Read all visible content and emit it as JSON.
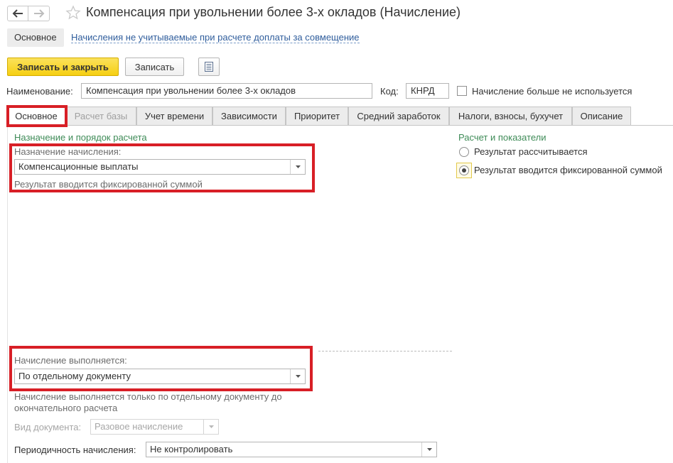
{
  "window": {
    "title": "Компенсация при увольнении более 3-х окладов (Начисление)"
  },
  "icons": {
    "back": "arrow-left-icon",
    "forward": "arrow-right-icon",
    "favorite": "star-icon",
    "list": "list-icon",
    "dropdown": "chevron-down-icon"
  },
  "subnav": {
    "main": "Основное",
    "link": "Начисления не учитываемые при расчете доплаты за совмещение"
  },
  "toolbar": {
    "save_close": "Записать и закрыть",
    "save": "Записать"
  },
  "header_fields": {
    "name_label": "Наименование:",
    "name_value": "Компенсация при увольнении более 3-х окладов",
    "code_label": "Код:",
    "code_value": "КНРД",
    "unused_label": "Начисление больше не используется"
  },
  "tabs": [
    {
      "label": "Основное",
      "active": true
    },
    {
      "label": "Расчет базы",
      "disabled": true
    },
    {
      "label": "Учет времени"
    },
    {
      "label": "Зависимости"
    },
    {
      "label": "Приоритет"
    },
    {
      "label": "Средний заработок"
    },
    {
      "label": "Налоги, взносы, бухучет"
    },
    {
      "label": "Описание"
    }
  ],
  "left_panel": {
    "section_title": "Назначение и порядок расчета",
    "purpose_label": "Назначение начисления:",
    "purpose_value": "Компенсационные выплаты",
    "purpose_hint": "Результат вводится фиксированной суммой",
    "execution_label": "Начисление выполняется:",
    "execution_value": "По отдельному документу",
    "execution_hint_line1": "Начисление выполняется только по отдельному документу до",
    "execution_hint_line2": "окончательного расчета",
    "doc_type_label": "Вид документа:",
    "doc_type_value": "Разовое начисление",
    "periodicity_label": "Периодичность начисления:",
    "periodicity_value": "Не контролировать"
  },
  "right_panel": {
    "section_title": "Расчет и показатели",
    "radio_calculated": "Результат рассчитывается",
    "radio_fixed": "Результат вводится фиксированной суммой",
    "selected": "fixed"
  },
  "colors": {
    "accent_yellow": "#f6cf12",
    "section_green": "#3e8b57",
    "link_blue": "#2f5d9c",
    "highlight_red": "#d81f26"
  }
}
